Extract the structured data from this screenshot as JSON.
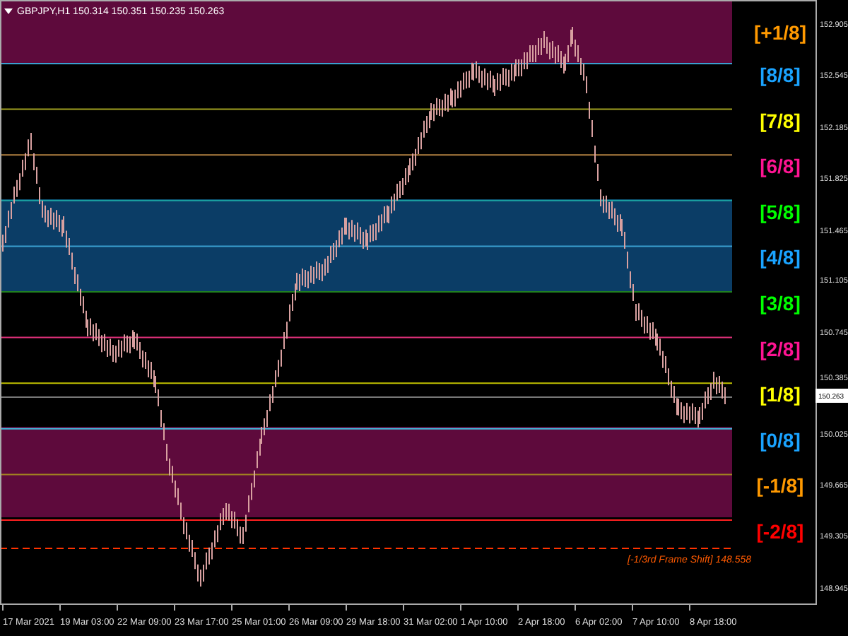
{
  "chart_title": "GBPJPY,H1  150.314 150.351 150.235 150.263",
  "levels": [
    {
      "label": "[+1/8]",
      "color": "#ff9900"
    },
    {
      "label": "[8/8]",
      "color": "#1aa3ff"
    },
    {
      "label": "[7/8]",
      "color": "#ffff00"
    },
    {
      "label": "[6/8]",
      "color": "#ff1493"
    },
    {
      "label": "[5/8]",
      "color": "#00ff00"
    },
    {
      "label": "[4/8]",
      "color": "#1aa3ff"
    },
    {
      "label": "[3/8]",
      "color": "#00ff00"
    },
    {
      "label": "[2/8]",
      "color": "#ff1493"
    },
    {
      "label": "[1/8]",
      "color": "#ffff00"
    },
    {
      "label": "[0/8]",
      "color": "#1aa3ff"
    },
    {
      "label": "[-1/8]",
      "color": "#ff9900"
    },
    {
      "label": "[-2/8]",
      "color": "#ff0000"
    }
  ],
  "frame_shift": {
    "label": "[-1/3rd Frame Shift]",
    "price": "148.558"
  },
  "price_axis": [
    "152.905",
    "152.545",
    "152.185",
    "151.825",
    "151.465",
    "151.105",
    "150.745",
    "150.385",
    "150.025",
    "149.665",
    "149.305",
    "148.945"
  ],
  "current_price": "150.263",
  "time_axis": [
    "17 Mar 2021",
    "19 Mar 03:00",
    "22 Mar 09:00",
    "23 Mar 17:00",
    "25 Mar 01:00",
    "26 Mar 09:00",
    "29 Mar 18:00",
    "31 Mar 02:00",
    "1 Apr 10:00",
    "2 Apr 18:00",
    "6 Apr 02:00",
    "7 Apr 10:00",
    "8 Apr 18:00"
  ]
}
